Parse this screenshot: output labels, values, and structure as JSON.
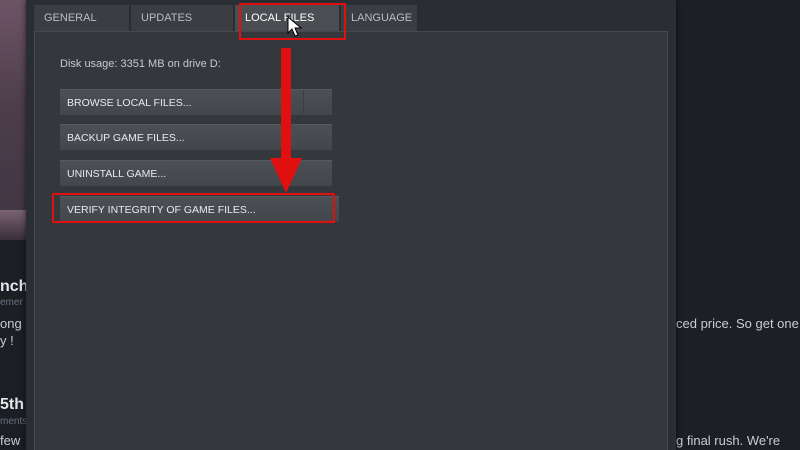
{
  "background": {
    "title_fragment_1": "nch",
    "sub_fragment_1": "emer",
    "body_fragment_1a": "ong l",
    "body_fragment_1b": "y !",
    "right_fragment_1": "ced price. So get one,",
    "title_fragment_2": "5th",
    "sub_fragment_2": "ments",
    "body_fragment_2": "few",
    "right_fragment_2": "g final rush. We're"
  },
  "dialog": {
    "tabs": [
      {
        "label": "GENERAL"
      },
      {
        "label": "UPDATES"
      },
      {
        "label": "LOCAL FILES",
        "active": true
      },
      {
        "label": "LANGUAGE"
      }
    ],
    "local_files": {
      "disk_usage": "Disk usage: 3351 MB on drive D:",
      "browse_button": "BROWSE LOCAL FILES...",
      "backup_button": "BACKUP GAME FILES...",
      "uninstall_button": "UNINSTALL GAME...",
      "verify_button": "VERIFY INTEGRITY OF GAME FILES..."
    }
  },
  "annotations": {
    "highlight_color": "#e01010",
    "arrow_color": "#e01010"
  },
  "colors": {
    "dialog_bg": "#2a2d33",
    "panel_bg": "#34373c",
    "button_bg": "#4c5055",
    "text": "#e8eaec"
  }
}
